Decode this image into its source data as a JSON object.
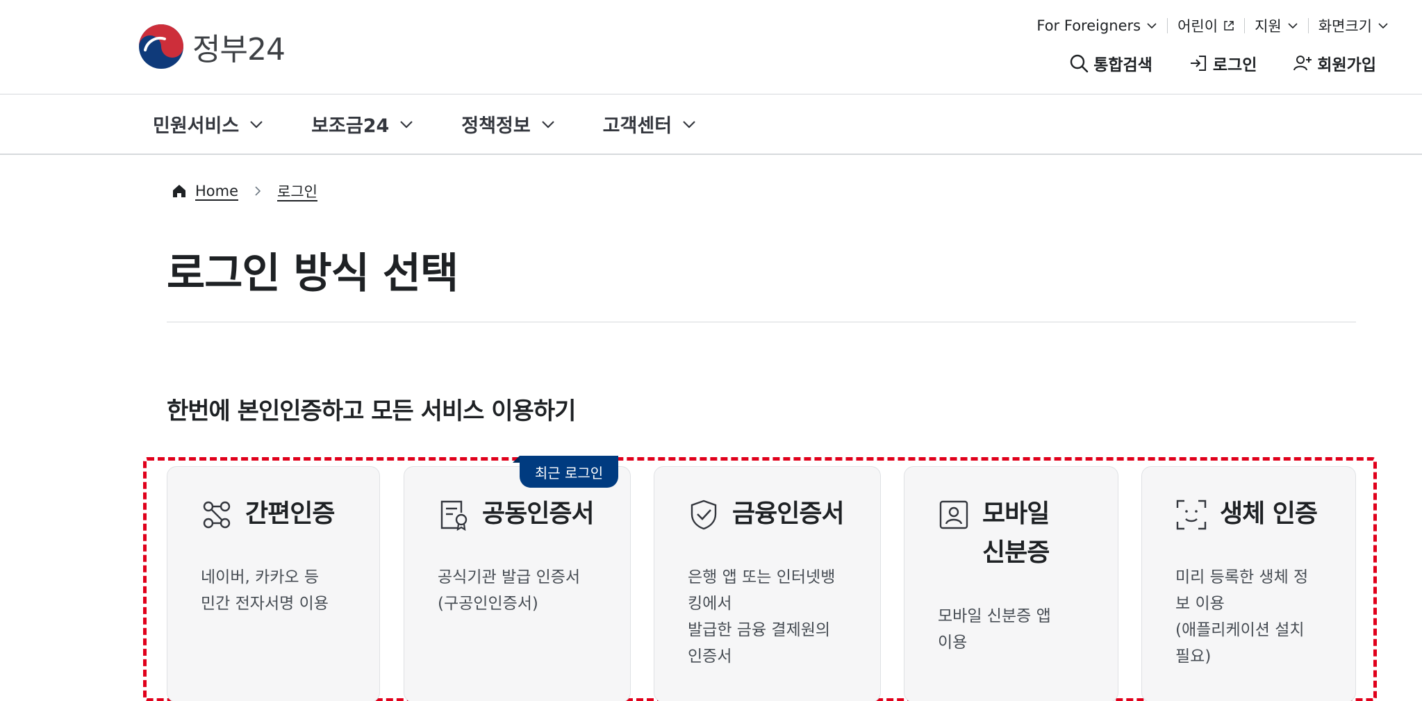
{
  "brand": {
    "name": "정부24",
    "colors": {
      "red": "#cd2e3a",
      "blue": "#0f3a7a",
      "accent_red": "#e0001b",
      "navy_badge": "#003b80"
    }
  },
  "utility": [
    {
      "label": "For Foreigners",
      "icon": "chevron-down-icon"
    },
    {
      "label": "어린이",
      "icon": "external-link-icon"
    },
    {
      "label": "지원",
      "icon": "chevron-down-icon"
    },
    {
      "label": "화면크기",
      "icon": "chevron-down-icon"
    }
  ],
  "actions": [
    {
      "label": "통합검색",
      "icon": "search-icon"
    },
    {
      "label": "로그인",
      "icon": "login-icon"
    },
    {
      "label": "회원가입",
      "icon": "user-plus-icon"
    }
  ],
  "gnb": [
    {
      "label": "민원서비스"
    },
    {
      "label": "보조금24"
    },
    {
      "label": "정책정보"
    },
    {
      "label": "고객센터"
    }
  ],
  "breadcrumb": {
    "home": "Home",
    "current": "로그인"
  },
  "page": {
    "title": "로그인 방식 선택",
    "section_title": "한번에 본인인증하고 모든 서비스 이용하기"
  },
  "badge": {
    "label": "최근 로그인"
  },
  "cards": [
    {
      "title": "간편인증",
      "icon": "simple-auth-icon",
      "desc": [
        "네이버, 카카오 등",
        "민간 전자서명 이용"
      ]
    },
    {
      "title": "공동인증서",
      "icon": "certificate-icon",
      "desc": [
        "공식기관 발급 인증서",
        "(구공인인증서)"
      ]
    },
    {
      "title": "금융인증서",
      "icon": "shield-check-icon",
      "desc": [
        "은행 앱 또는 인터넷뱅",
        "킹에서",
        "발급한 금융 결제원의",
        "인증서"
      ]
    },
    {
      "title_lines": [
        "모바일",
        "신분증"
      ],
      "icon": "id-card-icon",
      "desc": [
        "모바일 신분증 앱",
        "이용"
      ]
    },
    {
      "title": "생체 인증",
      "icon": "face-scan-icon",
      "desc": [
        "미리 등록한 생체 정",
        "보 이용",
        "(애플리케이션 설치",
        "필요)"
      ]
    }
  ]
}
